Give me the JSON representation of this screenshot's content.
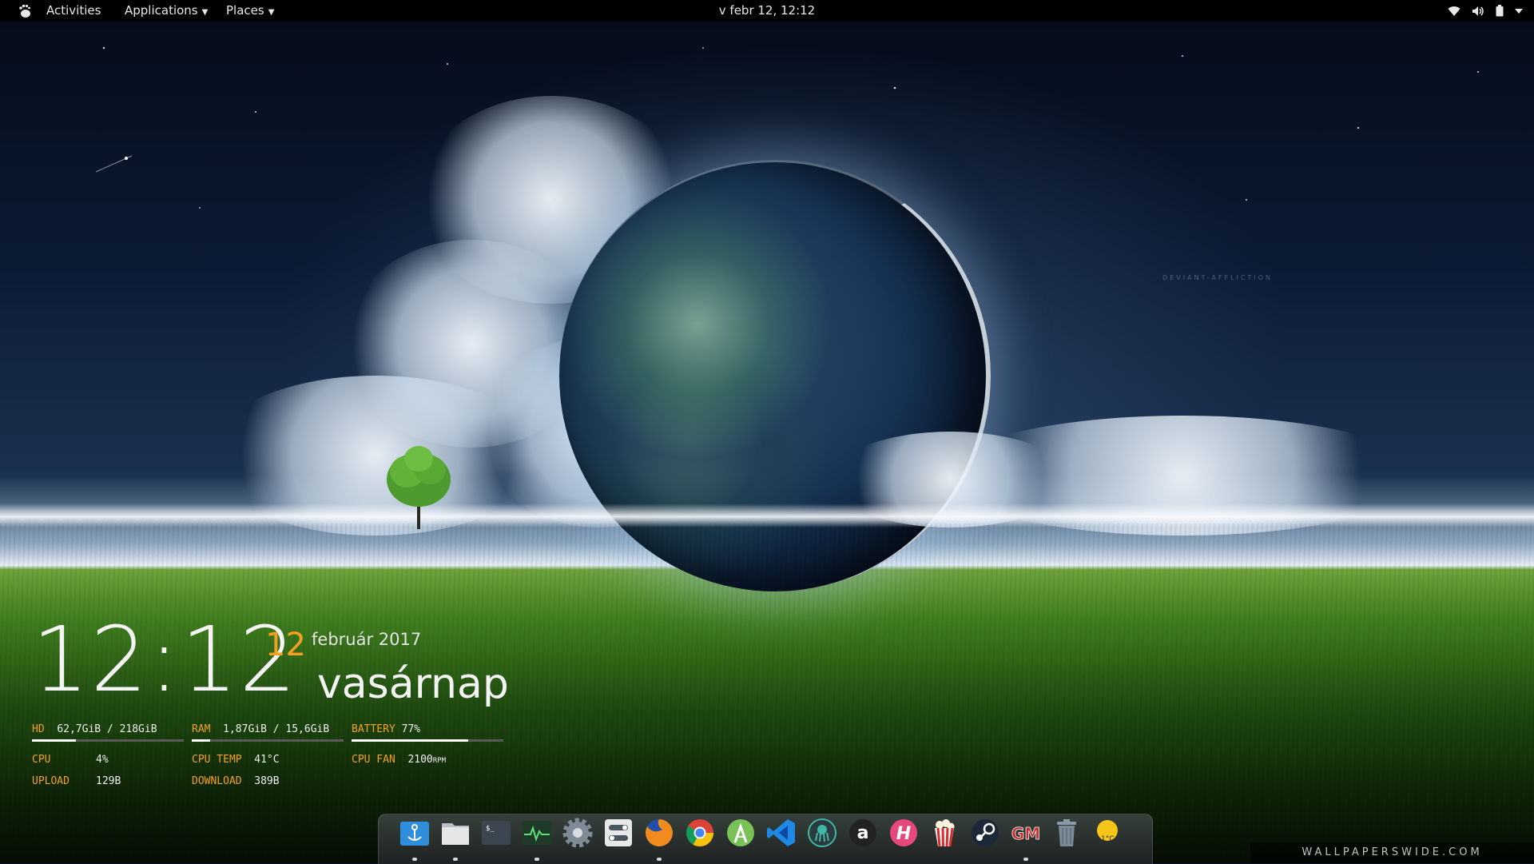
{
  "topbar": {
    "activities": "Activities",
    "applications": "Applications",
    "places": "Places",
    "clock": "v febr 12, 12:12",
    "tray_icons": [
      "wifi-icon",
      "volume-icon",
      "battery-icon",
      "power-menu-icon"
    ]
  },
  "wallpaper": {
    "signature": "DEVIANT-AFFLICTION",
    "site": "WALLPAPERSWIDE.COM"
  },
  "conky": {
    "time": "12:12",
    "day": "12",
    "month_year": "február 2017",
    "weekday": "vasárnap",
    "hd": {
      "label": "HD",
      "value": "62,7GiB / 218GiB",
      "fraction": 0.29
    },
    "ram": {
      "label": "RAM",
      "value": "1,87GiB / 15,6GiB",
      "fraction": 0.12
    },
    "battery": {
      "label": "BATTERY",
      "value": "77%",
      "fraction": 0.77
    },
    "cpu": {
      "label": "CPU",
      "value": "4%"
    },
    "cpu_temp": {
      "label": "CPU TEMP",
      "value": "41°C"
    },
    "cpu_fan": {
      "label": "CPU FAN",
      "value": "2100",
      "unit": "RPM"
    },
    "upload": {
      "label": "UPLOAD",
      "value": "129B"
    },
    "download": {
      "label": "DOWNLOAD",
      "value": "389B"
    }
  },
  "dock": {
    "apps": [
      {
        "name": "anchor-app-icon",
        "color": "#2f8fdc"
      },
      {
        "name": "files-icon",
        "color": "#e4e6e8"
      },
      {
        "name": "terminal-icon",
        "color": "#3b4650"
      },
      {
        "name": "system-monitor-icon",
        "color": "#2f5a38"
      },
      {
        "name": "settings-gear-icon",
        "color": "#7f8c98"
      },
      {
        "name": "tweaks-icon",
        "color": "#e8e8e8"
      },
      {
        "name": "firefox-icon",
        "color": "#f28b1e"
      },
      {
        "name": "chrome-icon",
        "color": "#4285f4"
      },
      {
        "name": "android-studio-icon",
        "color": "#78c257"
      },
      {
        "name": "vscode-icon",
        "color": "#1e88e5"
      },
      {
        "name": "gitkraken-icon",
        "color": "#2b3a3e"
      },
      {
        "name": "amazon-icon",
        "color": "#222222"
      },
      {
        "name": "hyper-icon",
        "color": "#e8477c"
      },
      {
        "name": "popcorn-time-icon",
        "color": "#d92b2b"
      },
      {
        "name": "steam-icon",
        "color": "#1b2838"
      },
      {
        "name": "gm-icon",
        "color": "#c62828"
      },
      {
        "name": "trash-icon",
        "color": "#7a8a96"
      },
      {
        "name": "weather-icon",
        "color": "#f5c518"
      }
    ],
    "weather_text": "1°C"
  }
}
